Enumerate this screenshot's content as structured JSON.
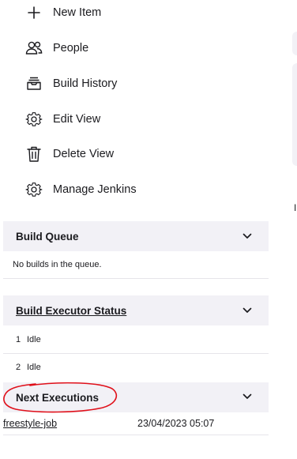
{
  "nav": {
    "items": [
      {
        "label": "New Item",
        "icon": "plus-icon"
      },
      {
        "label": "People",
        "icon": "people-icon"
      },
      {
        "label": "Build History",
        "icon": "inbox-icon"
      },
      {
        "label": "Edit View",
        "icon": "gear-icon"
      },
      {
        "label": "Delete View",
        "icon": "trash-icon"
      },
      {
        "label": "Manage Jenkins",
        "icon": "gear-icon"
      }
    ]
  },
  "build_queue": {
    "title": "Build Queue",
    "empty_text": "No builds in the queue."
  },
  "executors": {
    "title": "Build Executor Status",
    "items": [
      {
        "number": "1",
        "status": "Idle"
      },
      {
        "number": "2",
        "status": "Idle"
      }
    ]
  },
  "next_executions": {
    "title": "Next Executions",
    "rows": [
      {
        "job": "freestyle-job",
        "time": "23/04/2023 05:07"
      }
    ]
  },
  "right_edge": {
    "letter": "I"
  },
  "colors": {
    "panel_bg": "#f2f1f6",
    "annotation": "#e0101a"
  }
}
